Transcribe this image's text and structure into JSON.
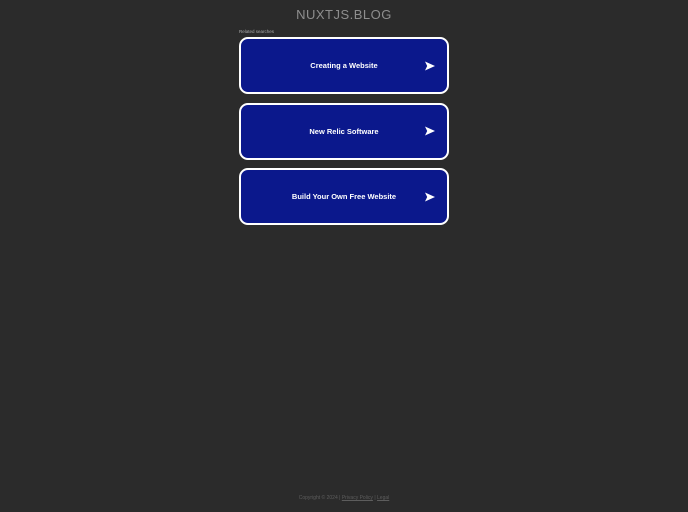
{
  "header": {
    "domain": "NUXTJS.BLOG"
  },
  "related": {
    "label": "Related searches",
    "items": [
      {
        "label": "Creating a Website",
        "icon": "arrow-right-icon"
      },
      {
        "label": "New Relic Software",
        "icon": "arrow-right-icon"
      },
      {
        "label": "Build Your Own Free Website",
        "icon": "arrow-right-icon"
      }
    ]
  },
  "footer": {
    "copyright": "Copyright © 2024",
    "separator": "|",
    "privacy_label": "Privacy Policy",
    "legal_label": "Legal"
  },
  "colors": {
    "background": "#2b2b2b",
    "button": "#0b188c",
    "button_border": "#ffffff"
  }
}
